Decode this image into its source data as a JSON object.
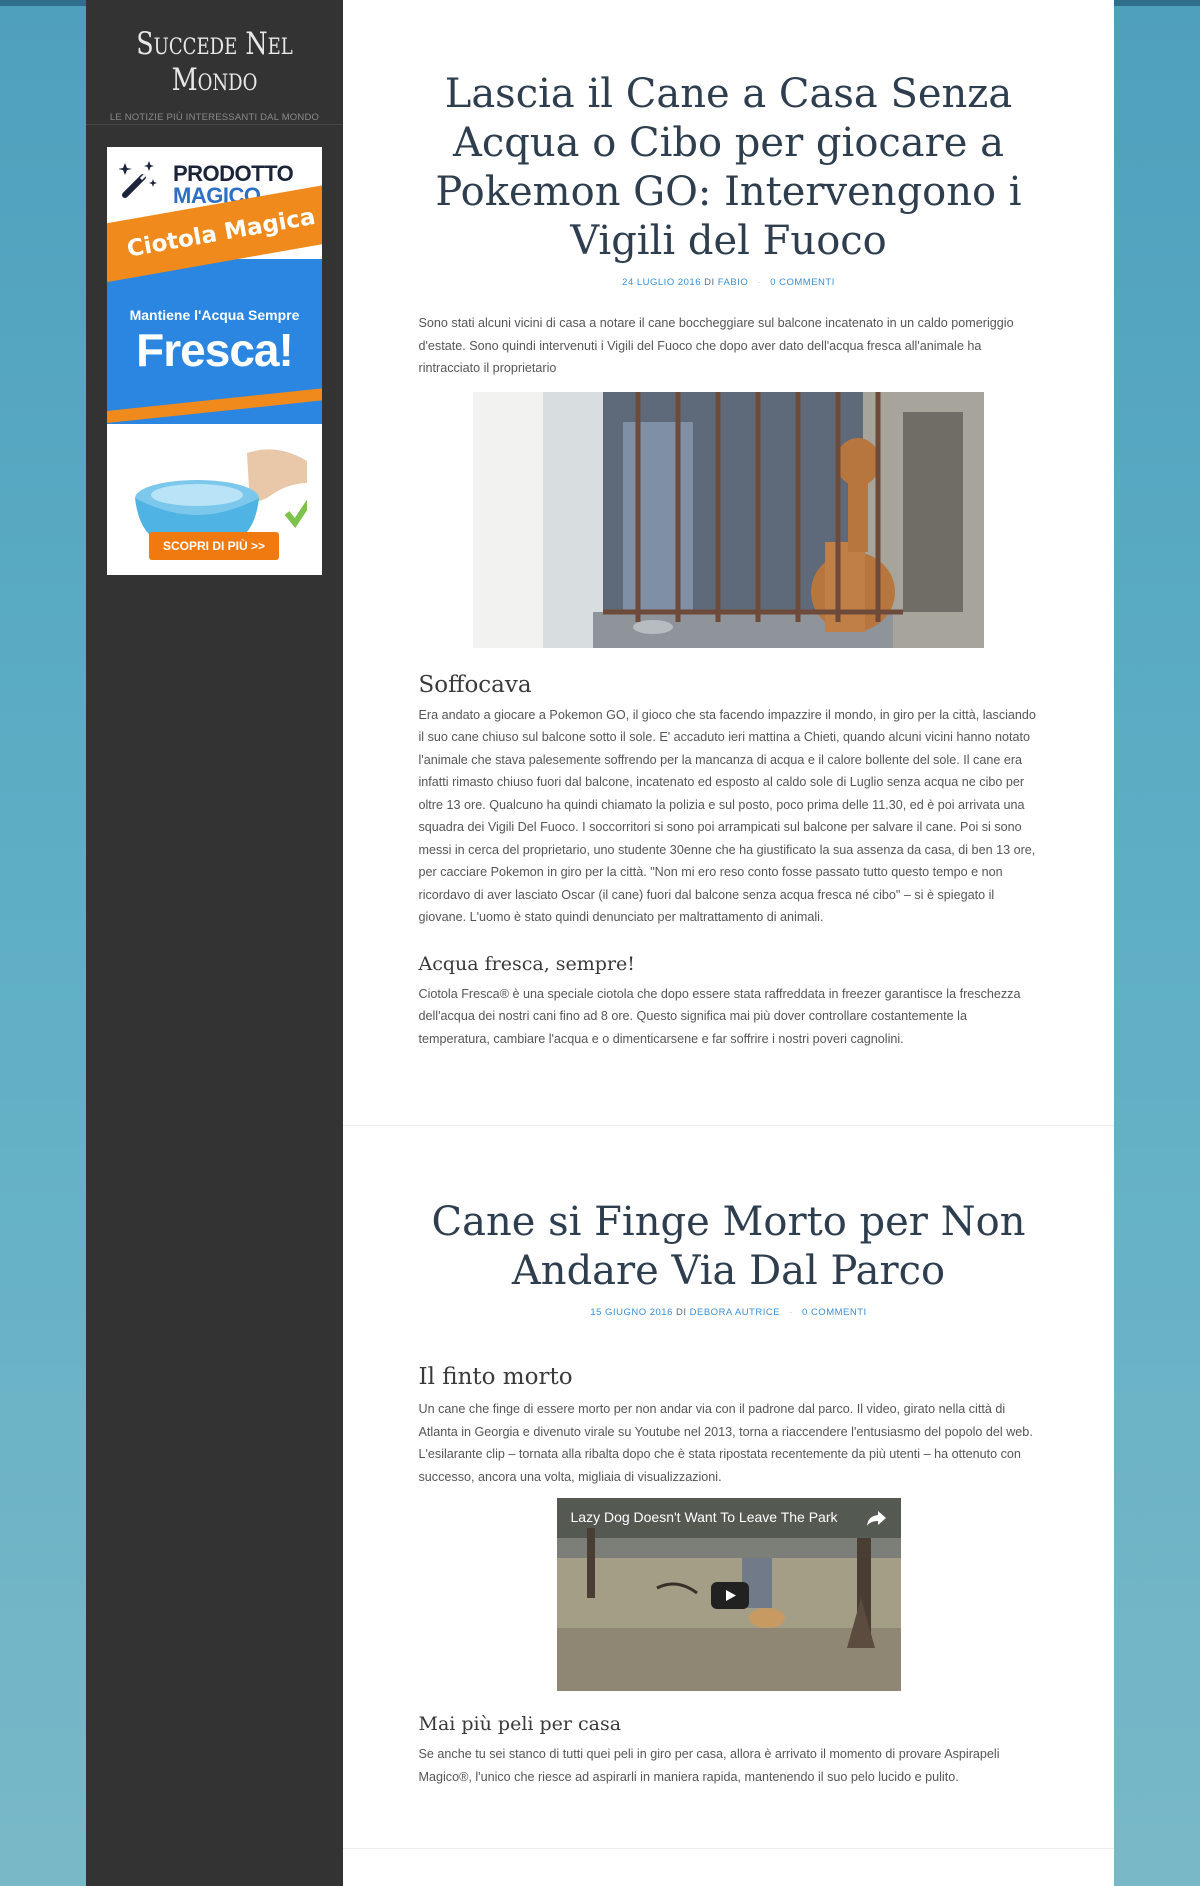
{
  "site": {
    "title": "Succede Nel Mondo",
    "description": "LE NOTIZIE PIÙ INTERESSANTI DAL MONDO"
  },
  "ad": {
    "brand_line1": "PRODOTTO",
    "brand_line2": "MAGICO",
    "ribbon": "Ciotola Magica",
    "tagline": "Mantiene l'Acqua Sempre",
    "headline": "Fresca!",
    "cta": "SCOPRI DI PIÙ >>",
    "colors": {
      "blue": "#2a86e0",
      "orange": "#f08a1c",
      "navy": "#1b2438"
    },
    "icons": [
      "magic-wand-icon",
      "checkmark-icon"
    ]
  },
  "posts": [
    {
      "title": "Lascia il Cane a Casa Senza Acqua o Cibo per giocare a Pokemon GO: Intervengono i Vigili del Fuoco",
      "date": "24 LUGLIO 2016",
      "by": "DI",
      "author": "FABIO",
      "comments": "0 COMMENTI",
      "intro": "Sono stati alcuni vicini di casa a notare il cane boccheggiare sul balcone incatenato in un caldo pomeriggio d'estate. Sono quindi intervenuti i Vigili del Fuoco che dopo aver dato dell'acqua fresca all'animale ha rintracciato il proprietario",
      "section1_heading": "Soffocava",
      "section1_text": "Era andato a giocare a Pokemon GO, il gioco che sta facendo impazzire il mondo, in giro per la città, lasciando il suo cane chiuso sul balcone sotto il sole. E' accaduto ieri mattina a Chieti, quando alcuni vicini hanno notato l'animale che stava palesemente soffrendo per la mancanza di acqua e il calore bollente del sole. Il cane era infatti rimasto chiuso fuori dal balcone, incatenato ed esposto al caldo sole di Luglio senza acqua ne cibo per oltre 13 ore. Qualcuno ha quindi chiamato la polizia e sul posto, poco prima delle 11.30, ed è poi arrivata una squadra dei Vigili Del Fuoco. I soccorritori si sono poi arrampicati sul balcone per salvare il cane. Poi si sono messi in cerca del proprietario, uno studente 30enne che ha giustificato la sua assenza da casa, di ben 13 ore, per cacciare Pokemon in giro per la città. \"Non mi ero reso conto fosse passato tutto questo tempo e non ricordavo di aver lasciato Oscar (il cane) fuori dal balcone senza acqua fresca né cibo\" – si è spiegato il giovane. L'uomo è stato quindi denunciato per maltrattamento di animali.",
      "section2_heading": "Acqua fresca, sempre!",
      "section2_text": "Ciotola Fresca® è una speciale ciotola che dopo essere stata raffreddata in freezer garantisce la freschezza dell'acqua dei nostri cani fino ad 8 ore. Questo significa mai più dover controllare costantemente la temperatura, cambiare l'acqua e o dimenticarsene e far soffrire i nostri poveri cagnolini."
    },
    {
      "title": "Cane si Finge Morto per Non Andare Via Dal Parco",
      "date": "15 GIUGNO 2016",
      "by": "DI",
      "author": "DEBORA AUTRICE",
      "comments": "0 COMMENTI",
      "section1_heading": "Il finto morto",
      "section1_text": "Un cane che finge di essere morto per non andar via con il padrone dal parco. Il video, girato nella città di Atlanta in Georgia e divenuto virale su Youtube nel 2013, torna a riaccendere l'entusiasmo del popolo del web. L'esilarante clip – tornata alla ribalta dopo che è stata ripostata recentemente da più utenti – ha ottenuto con successo, ancora una volta, migliaia di visualizzazioni.",
      "video_title": "Lazy Dog Doesn't Want To Leave The Park",
      "section2_heading": "Mai più peli per casa",
      "section2_text": "Se anche tu sei stanco di tutti quei peli in giro per casa, allora è arrivato il momento di provare Aspirapeli Magico®, l'unico che riesce ad aspirarli in maniera rapida, mantenendo il suo pelo lucido e pulito."
    }
  ]
}
